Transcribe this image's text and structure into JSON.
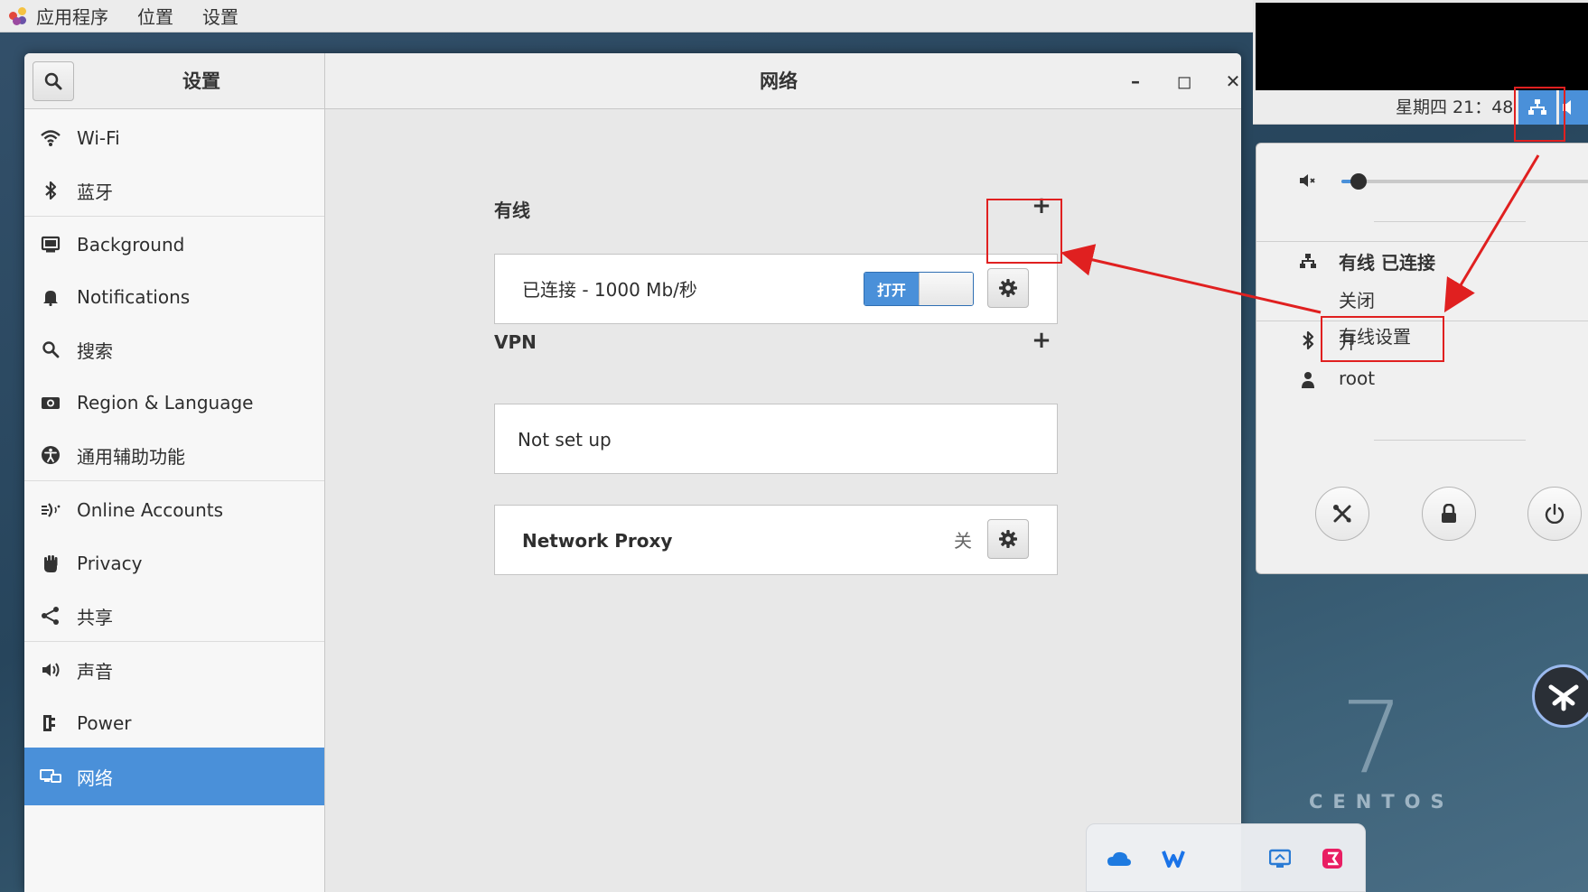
{
  "topbar": {
    "apps": "应用程序",
    "places": "位置",
    "settings": "设置"
  },
  "window": {
    "sidebar_title": "设置",
    "title": "网络",
    "controls": {
      "minimize": "–",
      "maximize": "◻",
      "close": "✕"
    }
  },
  "sidebar": {
    "items": [
      {
        "label": "Wi-Fi",
        "icon": "wifi-icon"
      },
      {
        "label": "蓝牙",
        "icon": "bluetooth-icon"
      },
      {
        "label": "Background",
        "icon": "background-icon"
      },
      {
        "label": "Notifications",
        "icon": "bell-icon"
      },
      {
        "label": "搜索",
        "icon": "search-icon"
      },
      {
        "label": "Region & Language",
        "icon": "camera-flag-icon"
      },
      {
        "label": "通用辅助功能",
        "icon": "accessibility-icon"
      },
      {
        "label": "Online Accounts",
        "icon": "online-accounts-icon"
      },
      {
        "label": "Privacy",
        "icon": "hand-icon"
      },
      {
        "label": "共享",
        "icon": "share-icon"
      },
      {
        "label": "声音",
        "icon": "speaker-icon"
      },
      {
        "label": "Power",
        "icon": "power-plug-icon"
      },
      {
        "label": "网络",
        "icon": "network-icon",
        "active": true
      }
    ]
  },
  "network": {
    "wired": {
      "title": "有线",
      "add": "+",
      "status": "已连接 - 1000 Mb/秒",
      "toggle_label": "打开",
      "toggle_on": true
    },
    "vpn": {
      "title": "VPN",
      "add": "+",
      "empty": "Not set up"
    },
    "proxy": {
      "label": "Network Proxy",
      "state": "关"
    }
  },
  "panel": {
    "clock": "星期四 21：48",
    "wired_status": "有线 已连接",
    "wired_off": "关闭",
    "wired_settings": "有线设置",
    "bluetooth": "开",
    "user": "root",
    "volume_level": 0.07
  },
  "desktop": {
    "logo_number": "7",
    "logo_text": "CENTOS"
  },
  "colors": {
    "accent": "#4a90d9",
    "annotation": "#e02020"
  }
}
